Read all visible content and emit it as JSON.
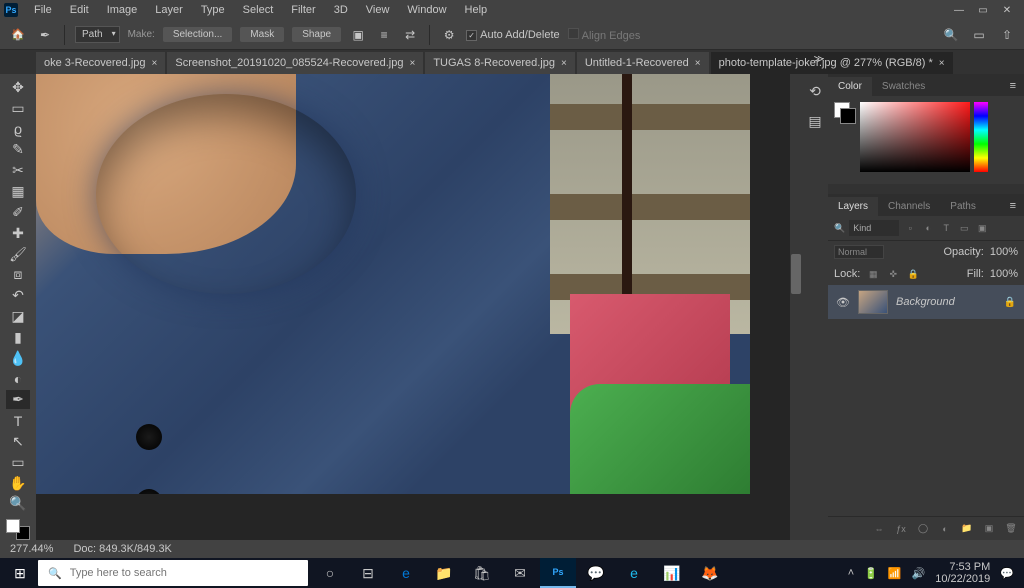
{
  "menubar": [
    "File",
    "Edit",
    "Image",
    "Layer",
    "Type",
    "Select",
    "Filter",
    "3D",
    "View",
    "Window",
    "Help"
  ],
  "optbar": {
    "path": "Path",
    "make": "Make:",
    "selection": "Selection...",
    "mask": "Mask",
    "shape": "Shape",
    "auto": "Auto Add/Delete",
    "align": "Align Edges"
  },
  "tabs": [
    {
      "label": "oke 3-Recovered.jpg"
    },
    {
      "label": "Screenshot_20191020_085524-Recovered.jpg"
    },
    {
      "label": "TUGAS 8-Recovered.jpg"
    },
    {
      "label": "Untitled-1-Recovered"
    },
    {
      "label": "photo-template-joker.jpg @ 277% (RGB/8) *"
    }
  ],
  "status": {
    "zoom": "277.44%",
    "doc": "Doc: 849.3K/849.3K"
  },
  "panels": {
    "color": {
      "tabs": [
        "Color",
        "Swatches"
      ]
    },
    "layers": {
      "tabs": [
        "Layers",
        "Channels",
        "Paths"
      ],
      "kind": "Kind",
      "blend": "Normal",
      "opacity_label": "Opacity:",
      "opacity": "100%",
      "lock_label": "Lock:",
      "fill_label": "Fill:",
      "fill": "100%",
      "layer_name": "Background"
    }
  },
  "taskbar": {
    "search_placeholder": "Type here to search",
    "time": "7:53 PM",
    "date": "10/22/2019"
  }
}
